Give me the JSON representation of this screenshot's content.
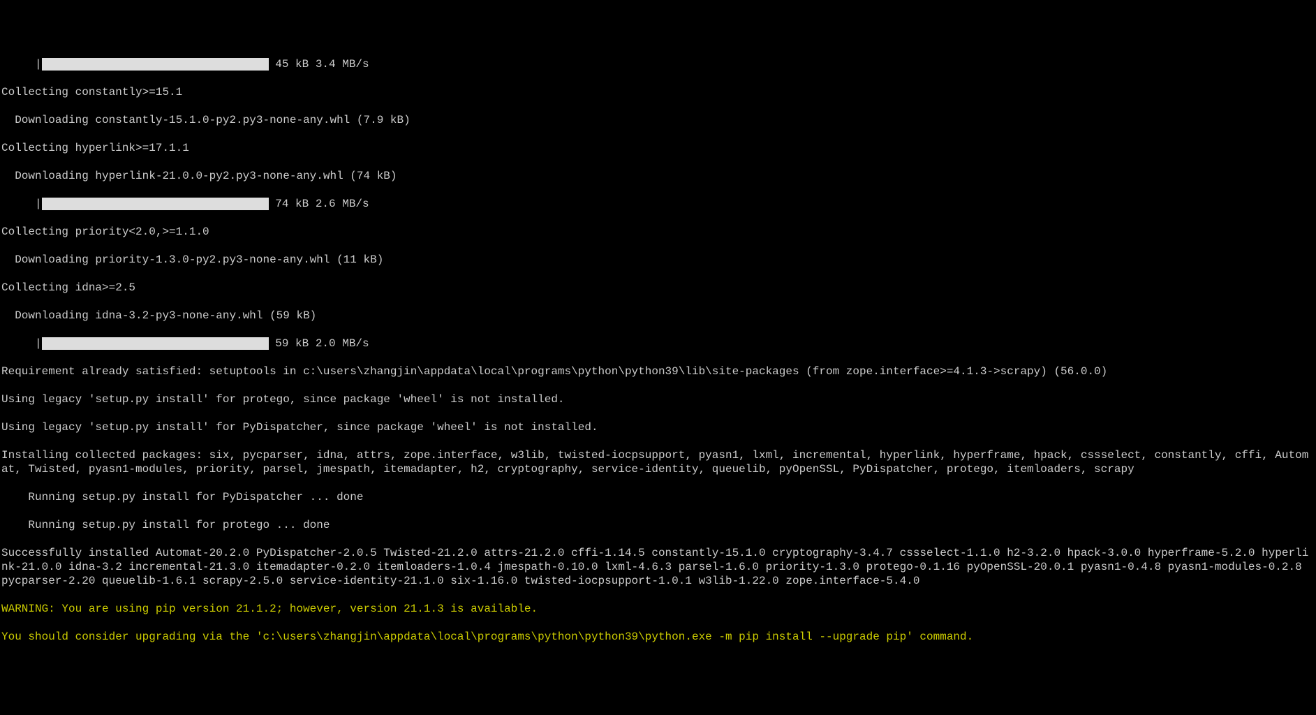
{
  "lines": {
    "progress1_indent": "     |",
    "progress1_text": " 45 kB 3.4 MB/s",
    "collect_constantly": "Collecting constantly>=15.1",
    "download_constantly": "  Downloading constantly-15.1.0-py2.py3-none-any.whl (7.9 kB)",
    "collect_hyperlink": "Collecting hyperlink>=17.1.1",
    "download_hyperlink": "  Downloading hyperlink-21.0.0-py2.py3-none-any.whl (74 kB)",
    "progress2_indent": "     |",
    "progress2_text": " 74 kB 2.6 MB/s",
    "collect_priority": "Collecting priority<2.0,>=1.1.0",
    "download_priority": "  Downloading priority-1.3.0-py2.py3-none-any.whl (11 kB)",
    "collect_idna": "Collecting idna>=2.5",
    "download_idna": "  Downloading idna-3.2-py3-none-any.whl (59 kB)",
    "progress3_indent": "     |",
    "progress3_text": " 59 kB 2.0 MB/s",
    "req_satisfied": "Requirement already satisfied: setuptools in c:\\users\\zhangjin\\appdata\\local\\programs\\python\\python39\\lib\\site-packages (from zope.interface>=4.1.3->scrapy) (56.0.0)",
    "legacy_protego": "Using legacy 'setup.py install' for protego, since package 'wheel' is not installed.",
    "legacy_pydispatcher": "Using legacy 'setup.py install' for PyDispatcher, since package 'wheel' is not installed.",
    "installing": "Installing collected packages: six, pycparser, idna, attrs, zope.interface, w3lib, twisted-iocpsupport, pyasn1, lxml, incremental, hyperlink, hyperframe, hpack, cssselect, constantly, cffi, Automat, Twisted, pyasn1-modules, priority, parsel, jmespath, itemadapter, h2, cryptography, service-identity, queuelib, pyOpenSSL, PyDispatcher, protego, itemloaders, scrapy",
    "running_pydispatcher": "    Running setup.py install for PyDispatcher ... done",
    "running_protego": "    Running setup.py install for protego ... done",
    "success": "Successfully installed Automat-20.2.0 PyDispatcher-2.0.5 Twisted-21.2.0 attrs-21.2.0 cffi-1.14.5 constantly-15.1.0 cryptography-3.4.7 cssselect-1.1.0 h2-3.2.0 hpack-3.0.0 hyperframe-5.2.0 hyperlink-21.0.0 idna-3.2 incremental-21.3.0 itemadapter-0.2.0 itemloaders-1.0.4 jmespath-0.10.0 lxml-4.6.3 parsel-1.6.0 priority-1.3.0 protego-0.1.16 pyOpenSSL-20.0.1 pyasn1-0.4.8 pyasn1-modules-0.2.8 pycparser-2.20 queuelib-1.6.1 scrapy-2.5.0 service-identity-21.1.0 six-1.16.0 twisted-iocpsupport-1.0.1 w3lib-1.22.0 zope.interface-5.4.0",
    "warning1": "WARNING: You are using pip version 21.1.2; however, version 21.1.3 is available.",
    "warning2": "You should consider upgrading via the 'c:\\users\\zhangjin\\appdata\\local\\programs\\python\\python39\\python.exe -m pip install --upgrade pip' command."
  }
}
